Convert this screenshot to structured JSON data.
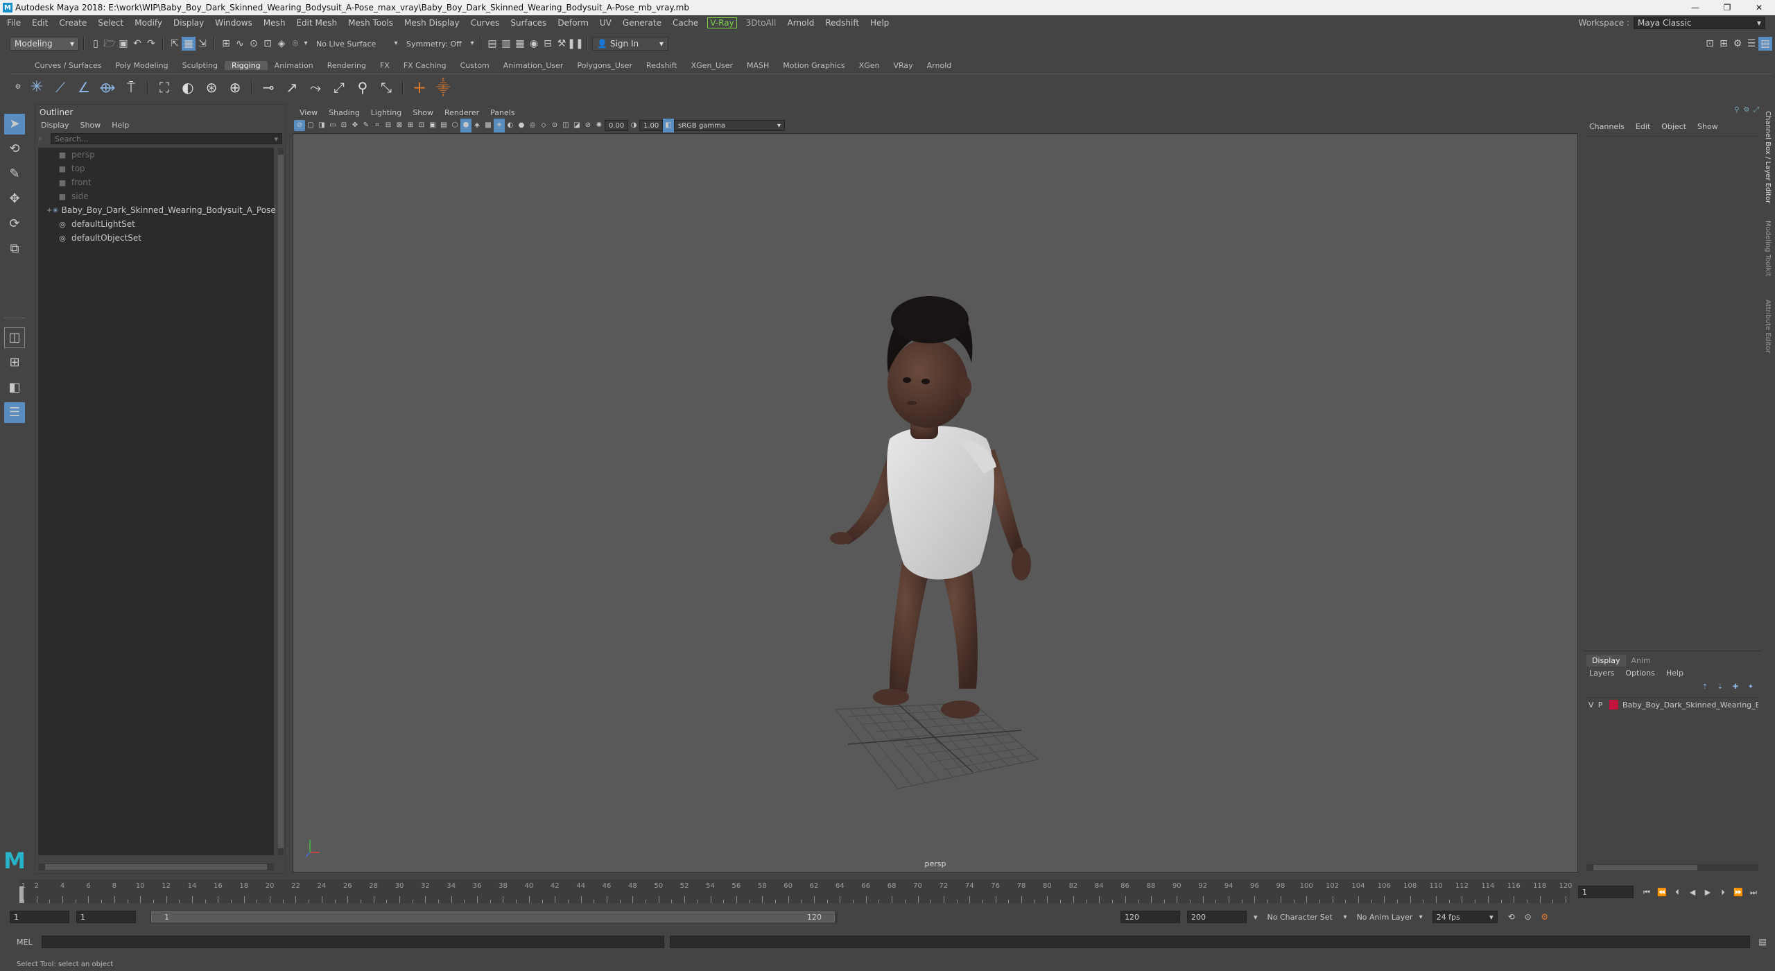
{
  "window": {
    "title": "Autodesk Maya 2018: E:\\work\\WIP\\Baby_Boy_Dark_Skinned_Wearing_Bodysuit_A-Pose_max_vray\\Baby_Boy_Dark_Skinned_Wearing_Bodysuit_A-Pose_mb_vray.mb",
    "controls": [
      "—",
      "❐",
      "✕"
    ]
  },
  "menu": {
    "items": [
      "File",
      "Edit",
      "Create",
      "Select",
      "Modify",
      "Display",
      "Windows",
      "Mesh",
      "Edit Mesh",
      "Mesh Tools",
      "Mesh Display",
      "Curves",
      "Surfaces",
      "Deform",
      "UV",
      "Generate",
      "Cache",
      "V-Ray",
      "3DtoAll",
      "Arnold",
      "Redshift",
      "Help"
    ],
    "workspace_label": "Workspace :",
    "workspace_value": "Maya Classic"
  },
  "status_line": {
    "mode": "Modeling",
    "live_surface": "No Live Surface",
    "symmetry": "Symmetry: Off",
    "sign_in": "Sign In"
  },
  "shelf": {
    "tabs": [
      "Curves / Surfaces",
      "Poly Modeling",
      "Sculpting",
      "Rigging",
      "Animation",
      "Rendering",
      "FX",
      "FX Caching",
      "Custom",
      "Animation_User",
      "Polygons_User",
      "Redshift",
      "XGen_User",
      "MASH",
      "Motion Graphics",
      "XGen",
      "VRay",
      "Arnold"
    ],
    "active_tab": "Rigging"
  },
  "outliner": {
    "title": "Outliner",
    "menu": [
      "Display",
      "Show",
      "Help"
    ],
    "search_placeholder": "Search...",
    "items": [
      {
        "label": "persp",
        "dim": true,
        "icon": "camera-icon"
      },
      {
        "label": "top",
        "dim": true,
        "icon": "camera-icon"
      },
      {
        "label": "front",
        "dim": true,
        "icon": "camera-icon"
      },
      {
        "label": "side",
        "dim": true,
        "icon": "camera-icon"
      },
      {
        "label": "Baby_Boy_Dark_Skinned_Wearing_Bodysuit_A_Pose",
        "dim": false,
        "icon": "joint-icon",
        "expand": "+"
      },
      {
        "label": "defaultLightSet",
        "dim": false,
        "icon": "set-icon"
      },
      {
        "label": "defaultObjectSet",
        "dim": false,
        "icon": "set-icon"
      }
    ]
  },
  "viewport": {
    "menu": [
      "View",
      "Shading",
      "Lighting",
      "Show",
      "Renderer",
      "Panels"
    ],
    "exposure": "0.00",
    "gamma": "1.00",
    "color_space": "sRGB gamma",
    "camera_label": "persp"
  },
  "channel_box": {
    "menu": [
      "Channels",
      "Edit",
      "Object",
      "Show"
    ],
    "side_tabs": [
      "Channel Box / Layer Editor",
      "Modeling Toolkit",
      "Attribute Editor"
    ]
  },
  "layer_editor": {
    "tabs": [
      "Display",
      "Anim"
    ],
    "menu": [
      "Layers",
      "Options",
      "Help"
    ],
    "layer": {
      "v": "V",
      "p": "P",
      "name": "Baby_Boy_Dark_Skinned_Wearing_Bc",
      "color": "#c0143c"
    }
  },
  "timeline": {
    "ticks": [
      1,
      2,
      4,
      6,
      8,
      10,
      12,
      14,
      16,
      18,
      20,
      22,
      24,
      26,
      28,
      30,
      32,
      34,
      36,
      38,
      40,
      42,
      44,
      46,
      48,
      50,
      52,
      54,
      56,
      58,
      60,
      62,
      64,
      66,
      68,
      70,
      72,
      74,
      76,
      78,
      80,
      82,
      84,
      86,
      88,
      90,
      92,
      94,
      96,
      98,
      100,
      102,
      104,
      106,
      108,
      110,
      112,
      114,
      116,
      118,
      120
    ],
    "current_frame": "1"
  },
  "range": {
    "start": "1",
    "playback_start": "1",
    "slider_start": "1",
    "slider_end": "120",
    "playback_end": "120",
    "end": "200",
    "character_set": "No Character Set",
    "anim_layer": "No Anim Layer",
    "fps": "24 fps"
  },
  "command_line": {
    "label": "MEL"
  },
  "help_line": {
    "text": "Select Tool: select an object"
  },
  "colors": {
    "bg": "#444444",
    "panel": "#444444",
    "viewport": "#5a5a5a",
    "field": "#2b2b2b",
    "accent": "#5a8dbf",
    "vray": "#7ad34a"
  }
}
